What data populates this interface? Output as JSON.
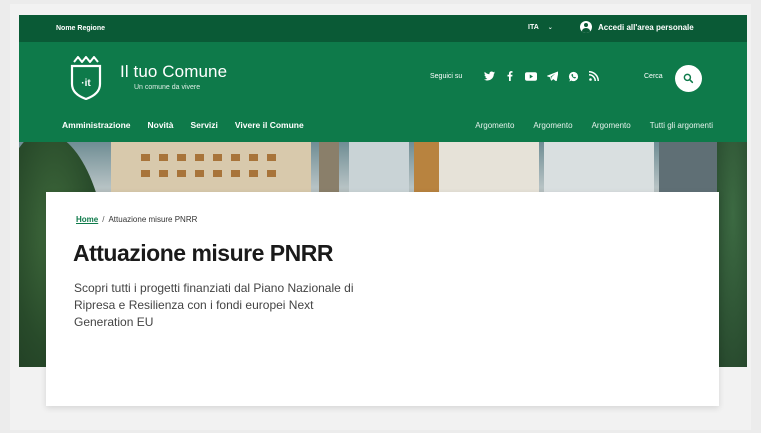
{
  "topbar": {
    "region": "Nome Regione",
    "lang": "ITA",
    "access_label": "Accedi all'area personale"
  },
  "header": {
    "logo_text": "·it",
    "title": "Il tuo Comune",
    "subtitle": "Un comune da vivere",
    "follow_label": "Seguici su",
    "socials": [
      "twitter-icon",
      "facebook-icon",
      "youtube-icon",
      "telegram-icon",
      "whatsapp-icon",
      "rss-icon"
    ],
    "search_label": "Cerca"
  },
  "nav": {
    "main": [
      "Amministrazione",
      "Novità",
      "Servizi",
      "Vivere il Comune"
    ],
    "topics": [
      "Argomento",
      "Argomento",
      "Argomento",
      "Tutti gli argomenti"
    ]
  },
  "breadcrumb": {
    "home": "Home",
    "separator": "/",
    "current": "Attuazione misure PNRR"
  },
  "page": {
    "title": "Attuazione misure PNRR",
    "description": "Scopri tutti i progetti finanziati dal Piano Nazionale di Ripresa e Resilienza con i fondi europei Next Generation EU"
  },
  "colors": {
    "brand": "#0e7a4a",
    "brand_dark": "#0a5a36"
  }
}
